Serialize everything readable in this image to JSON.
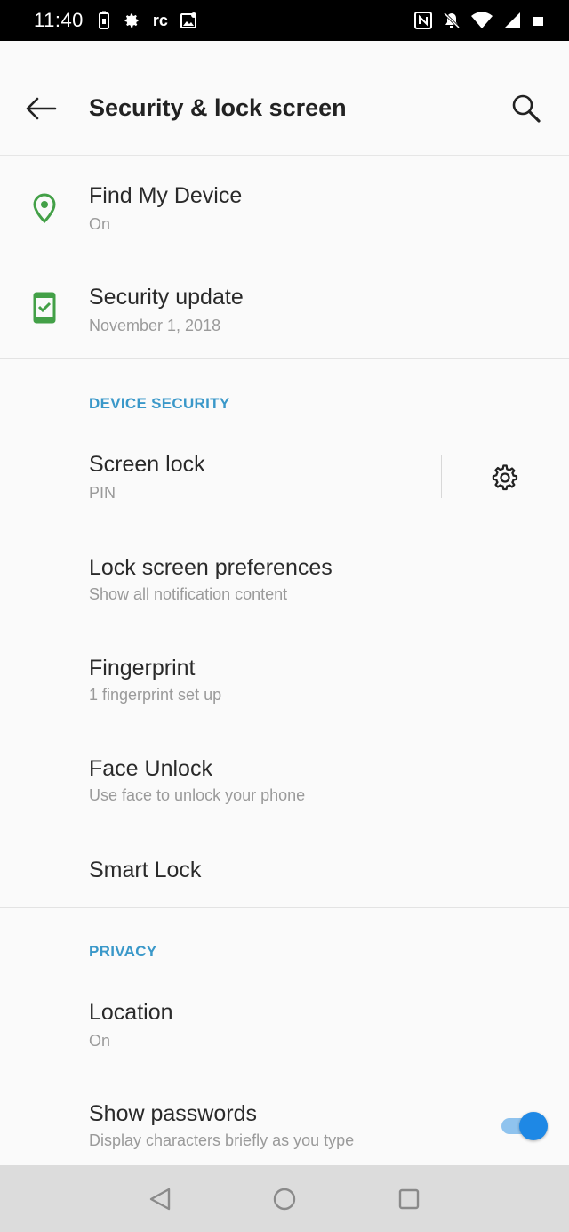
{
  "status_bar": {
    "time": "11:40",
    "carrier_text": "rc",
    "icons": [
      "battery-saver-icon",
      "settings-icon",
      "rc-icon",
      "photo-icon",
      "nfc-icon",
      "mute-icon",
      "wifi-icon",
      "signal-icon",
      "battery-icon"
    ]
  },
  "app_bar": {
    "title": "Security & lock screen",
    "back_icon": "arrow-left-icon",
    "search_icon": "search-icon"
  },
  "top_items": [
    {
      "title": "Find My Device",
      "subtitle": "On",
      "icon": "location-pin-icon"
    },
    {
      "title": "Security update",
      "subtitle": "November 1, 2018",
      "icon": "phone-check-icon"
    }
  ],
  "device_security": {
    "header": "DEVICE SECURITY",
    "items": [
      {
        "title": "Screen lock",
        "subtitle": "PIN"
      },
      {
        "title": "Lock screen preferences",
        "subtitle": "Show all notification content"
      },
      {
        "title": "Fingerprint",
        "subtitle": "1 fingerprint set up"
      },
      {
        "title": "Face Unlock",
        "subtitle": "Use face to unlock your phone"
      },
      {
        "title": "Smart Lock",
        "subtitle": ""
      }
    ]
  },
  "privacy": {
    "header": "PRIVACY",
    "items": [
      {
        "title": "Location",
        "subtitle": "On"
      },
      {
        "title": "Show passwords",
        "subtitle": "Display characters briefly as you type",
        "toggle_on": true
      }
    ]
  },
  "colors": {
    "accent": "#3a98c9",
    "icon_green": "#43a047",
    "toggle_on": "#1e88e5"
  },
  "nav_bar": {
    "icons": [
      "back-triangle-icon",
      "home-circle-icon",
      "recents-square-icon"
    ]
  }
}
